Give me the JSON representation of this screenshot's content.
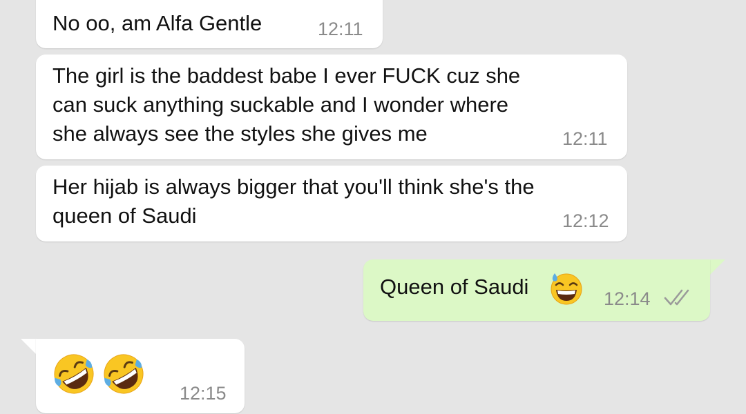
{
  "theme": {
    "chat_background": "#e5e5e5",
    "incoming_bubble": "#ffffff",
    "outgoing_bubble": "#dcf8c6",
    "timestamp_color": "#8a8a8a",
    "tick_color": "#9a9a9a"
  },
  "messages": [
    {
      "direction": "incoming",
      "text": "No oo, am Alfa Gentle",
      "time": "12:11"
    },
    {
      "direction": "incoming",
      "text": "The girl is the baddest babe I ever FUCK cuz she\ncan suck anything suckable and I wonder where\nshe always see the styles she gives me",
      "time": "12:11"
    },
    {
      "direction": "incoming",
      "text": "Her hijab is always bigger that you'll think she's the\nqueen of Saudi",
      "time": "12:12"
    },
    {
      "direction": "outgoing",
      "text": "Queen of Saudi",
      "emoji": "grinning-squinting-face-with-sweat-icon",
      "time": "12:14",
      "status_icon": "double-check-icon"
    },
    {
      "direction": "incoming",
      "emoji": [
        "rolling-on-floor-laughing-icon",
        "rolling-on-floor-laughing-icon"
      ],
      "time": "12:15"
    }
  ]
}
